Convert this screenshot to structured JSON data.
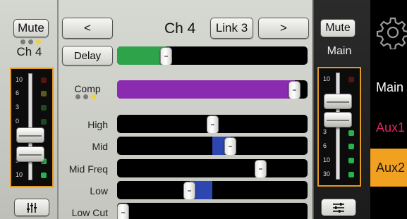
{
  "channel_strip": {
    "mute_label": "Mute",
    "channel_name": "Ch 4",
    "meter_scale": [
      "10",
      "6",
      "3",
      "0",
      "3",
      "10",
      "30"
    ],
    "fader_level": 0.52,
    "settings_icon": "sliders-vertical-icon"
  },
  "header": {
    "prev_label": "<",
    "title": "Ch 4",
    "link_label": "Link 3",
    "next_label": ">"
  },
  "delay": {
    "label": "Delay",
    "level": 0.24
  },
  "comp": {
    "label": "Comp",
    "level": 0.96
  },
  "eq": {
    "high_label": "High",
    "high_value": 0.5,
    "mid_label": "Mid",
    "mid_value": 0.6,
    "midfreq_label": "Mid Freq",
    "midfreq_value": 0.77,
    "low_label": "Low",
    "low_value": 0.37,
    "lowcut_label": "Low Cut",
    "lowcut_value": 0.0
  },
  "main_strip": {
    "mute_label": "Mute",
    "name": "Main",
    "meter_scale": [
      "10",
      "6",
      "3",
      "0",
      "3",
      "6",
      "10",
      "30"
    ],
    "fader_level": 0.7,
    "settings_icon": "sliders-horizontal-icon"
  },
  "nav": {
    "gear_icon": "gear-icon",
    "items": [
      {
        "label": "Main",
        "color": "#ffffff"
      },
      {
        "label": "Aux1",
        "color": "#e0245e"
      },
      {
        "label": "Aux2",
        "color": "#1a1a1a",
        "active": true
      }
    ]
  },
  "colors": {
    "delay_fill": "#2fa34a",
    "comp_fill": "#8a2bb0",
    "eq_fill": "#2d46b0",
    "meter_border": "#e39a22",
    "active_nav": "#f2a020"
  }
}
